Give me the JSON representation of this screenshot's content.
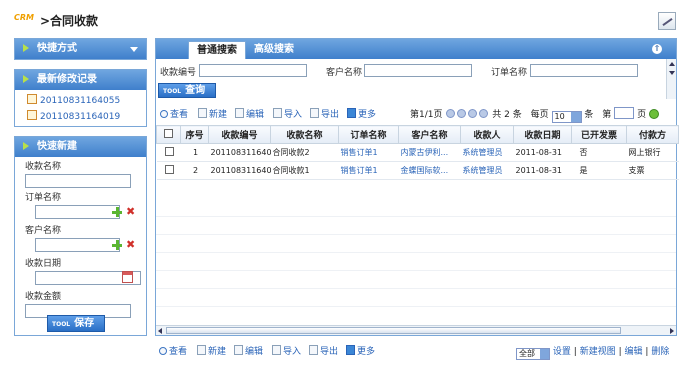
{
  "header": {
    "logo_text": "CRM",
    "title": ">合同收款"
  },
  "quick": {
    "title": "快捷方式"
  },
  "recent": {
    "title": "最新修改记录",
    "items": [
      "20110831164055",
      "20110831164019"
    ]
  },
  "new_form": {
    "title": "快速新建",
    "fields": {
      "receipt_name": "收款名称",
      "order_name": "订单名称",
      "customer_name": "客户名称",
      "receipt_date": "收款日期",
      "receipt_amount": "收款金额"
    },
    "save_tool": "TOOL",
    "save_label": "保存"
  },
  "tabs": {
    "basic": "普通搜索",
    "advanced": "高级搜索"
  },
  "search": {
    "receipt_no": "收款编号",
    "customer": "客户名称",
    "order": "订单名称",
    "tool": "TOOL",
    "query": "查询"
  },
  "toolbar": {
    "view": "查看",
    "new": "新建",
    "edit": "编辑",
    "import": "导入",
    "export": "导出",
    "more": "更多"
  },
  "pager": {
    "page_info": "第1/1页",
    "total_prefix": "共",
    "total": "2",
    "total_suffix": "条",
    "per_page_label": "每页",
    "per_page": "10",
    "per_unit": "条",
    "goto_prefix": "第",
    "goto_suffix": "页"
  },
  "columns": [
    "序号",
    "收款编号",
    "收款名称",
    "订单名称",
    "客户名称",
    "收款人",
    "收款日期",
    "已开发票",
    "付款方"
  ],
  "rows": [
    {
      "no": "1",
      "receipt_no": "20110831164055",
      "receipt_name": "合同收款2",
      "order": "销售订单1",
      "customer": "内蒙古伊利...",
      "payee": "系统管理员",
      "date": "2011-08-31",
      "invoiced": "否",
      "pay": "网上银行"
    },
    {
      "no": "2",
      "receipt_no": "20110831164019",
      "receipt_name": "合同收款1",
      "order": "销售订单1",
      "customer": "金蝶国际软...",
      "payee": "系统管理员",
      "date": "2011-08-31",
      "invoiced": "是",
      "pay": "支票"
    }
  ],
  "bottom": {
    "view_select": "全部",
    "settings": "设置",
    "new_view": "新建视图",
    "edit": "编辑",
    "delete": "删除",
    "sep": "|"
  }
}
